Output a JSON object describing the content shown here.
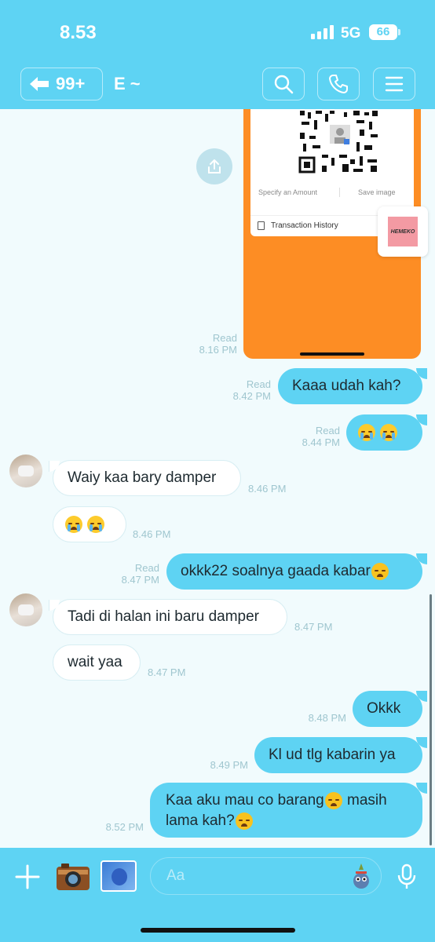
{
  "status_bar": {
    "time": "8.53",
    "network": "5G",
    "battery": "66"
  },
  "header": {
    "back_count": "99+",
    "chat_name": "E ~"
  },
  "image_message": {
    "wallet_options": [
      "Specify an Amount",
      "Save image"
    ],
    "transaction_label": "Transaction History",
    "meta": {
      "read": "Read",
      "time": "8.16 PM"
    }
  },
  "shared_card": {
    "logo_text": "HEMEKO"
  },
  "messages": [
    {
      "side": "me",
      "text": "Kaaa udah kah?",
      "read": "Read",
      "time": "8.42 PM"
    },
    {
      "side": "me",
      "text": "",
      "read": "Read",
      "time": "8.44 PM"
    },
    {
      "side": "them",
      "text": "Waiy kaa bary damper",
      "time": "8.46 PM"
    },
    {
      "side": "them",
      "text": "",
      "time": "8.46 PM"
    },
    {
      "side": "me",
      "text": "okkk22 soalnya gaada kabar",
      "read": "Read",
      "time": "8.47 PM"
    },
    {
      "side": "them",
      "text": "Tadi di halan ini baru damper",
      "time": "8.47 PM"
    },
    {
      "side": "them",
      "text": "wait yaa",
      "time": "8.47 PM"
    },
    {
      "side": "me",
      "text": "Okkk",
      "time": "8.48 PM"
    },
    {
      "side": "me",
      "text": "Kl ud tlg kabarin ya",
      "time": "8.49 PM"
    },
    {
      "side": "me",
      "text_line1": "Kaa aku mau co barang",
      "text_line1b": "masih",
      "text_line2": "lama kah?",
      "time": "8.52 PM"
    }
  ],
  "composer": {
    "placeholder": "Aa"
  },
  "colors": {
    "accent": "#5ed3f3",
    "background": "#f1fbfd",
    "image_bg": "#fd8d24"
  }
}
